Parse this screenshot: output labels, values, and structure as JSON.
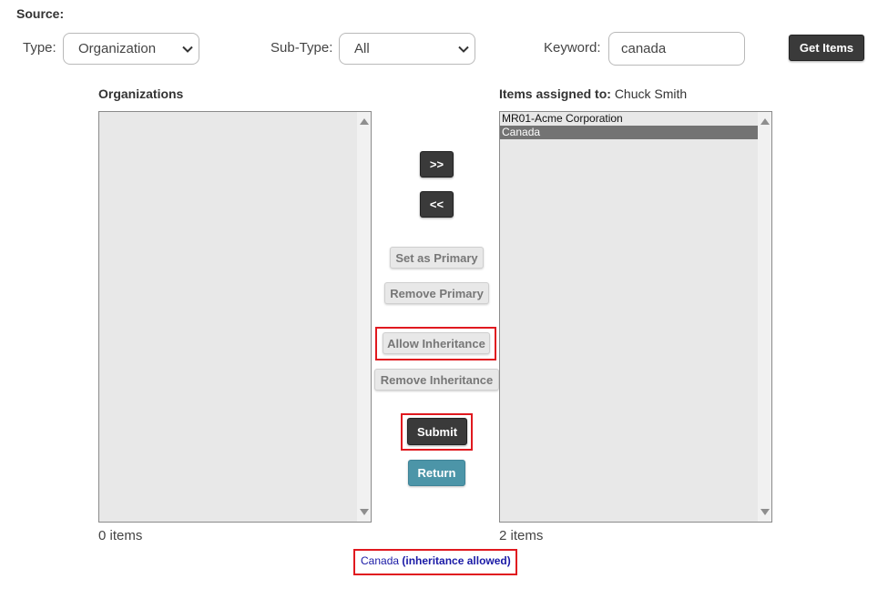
{
  "source": {
    "label": "Source:"
  },
  "filters": {
    "type_label": "Type:",
    "type_value": "Organization",
    "subtype_label": "Sub-Type:",
    "subtype_value": "All",
    "keyword_label": "Keyword:",
    "keyword_value": "canada",
    "get_items_label": "Get Items"
  },
  "left_panel": {
    "title": "Organizations",
    "items": [],
    "count_text": "0 items"
  },
  "right_panel": {
    "title_prefix": "Items assigned to:",
    "title_user": "Chuck Smith",
    "items": [
      {
        "label": "MR01-Acme Corporation",
        "selected": false
      },
      {
        "label": "Canada",
        "selected": true
      }
    ],
    "count_text": "2 items"
  },
  "actions": {
    "add_label": ">>",
    "remove_label": "<<",
    "set_primary_label": "Set as Primary",
    "remove_primary_label": "Remove Primary",
    "allow_inheritance_label": "Allow Inheritance",
    "remove_inheritance_label": "Remove Inheritance",
    "submit_label": "Submit",
    "return_label": "Return"
  },
  "status": {
    "name": "Canada",
    "detail": "(inheritance allowed)"
  },
  "colors": {
    "dark_button": "#3a3a3a",
    "teal_button": "#4c95a8",
    "highlight_border": "#e0191f",
    "status_text": "#1a1aa6",
    "selected_row": "#737373"
  }
}
